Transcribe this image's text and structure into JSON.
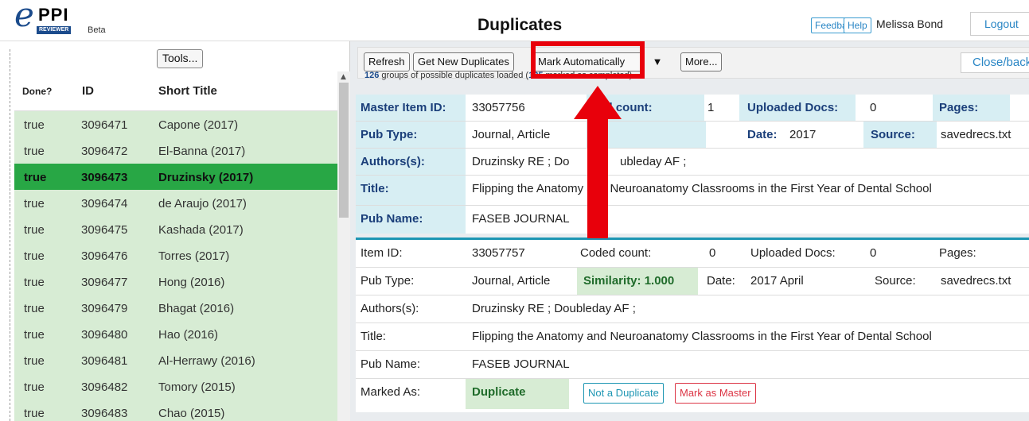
{
  "header": {
    "logo_letter": "e",
    "logo_main": "PPI",
    "logo_reviewer": "REVIEWER",
    "logo_beta": "Beta",
    "title": "Duplicates",
    "feedback": "Feedback",
    "help": "Help",
    "user": "Melissa Bond",
    "logout": "Logout"
  },
  "left": {
    "tools": "Tools...",
    "columns": {
      "done": "Done?",
      "id": "ID",
      "short_title": "Short Title"
    },
    "rows": [
      {
        "done": "true",
        "id": "3096471",
        "title": "Capone (2017)",
        "selected": false
      },
      {
        "done": "true",
        "id": "3096472",
        "title": "El-Banna (2017)",
        "selected": false
      },
      {
        "done": "true",
        "id": "3096473",
        "title": "Druzinsky (2017)",
        "selected": true
      },
      {
        "done": "true",
        "id": "3096474",
        "title": "de Araujo (2017)",
        "selected": false
      },
      {
        "done": "true",
        "id": "3096475",
        "title": "Kashada (2017)",
        "selected": false
      },
      {
        "done": "true",
        "id": "3096476",
        "title": "Torres (2017)",
        "selected": false
      },
      {
        "done": "true",
        "id": "3096477",
        "title": "Hong (2016)",
        "selected": false
      },
      {
        "done": "true",
        "id": "3096479",
        "title": "Bhagat (2016)",
        "selected": false
      },
      {
        "done": "true",
        "id": "3096480",
        "title": "Hao (2016)",
        "selected": false
      },
      {
        "done": "true",
        "id": "3096481",
        "title": "Al-Herrawy (2016)",
        "selected": false
      },
      {
        "done": "true",
        "id": "3096482",
        "title": "Tomory (2015)",
        "selected": false
      },
      {
        "done": "true",
        "id": "3096483",
        "title": "Chao (2015)",
        "selected": false
      }
    ]
  },
  "toolbar": {
    "refresh": "Refresh",
    "get_new": "Get New Duplicates",
    "mark_auto": "Mark Automatically",
    "dropdown_icon": "caret-down-icon",
    "more": "More...",
    "close_back": "Close/back",
    "status_count": "126",
    "status_mid": " groups of possible duplicates loaded (",
    "status_marked": "125",
    "status_end": " marked as completed)."
  },
  "master": {
    "item_id_label": "Master Item ID:",
    "item_id": "33057756",
    "coded_label": "ded count:",
    "coded": "1",
    "uploaded_label": "Uploaded Docs:",
    "uploaded": "0",
    "pages_label": "Pages:",
    "pubtype_label": "Pub Type:",
    "pubtype": "Journal, Article",
    "date_label": "Date:",
    "date": "2017",
    "source_label": "Source:",
    "source": "savedrecs.txt",
    "authors_label": "Authors(s):",
    "authors_a": "Druzinsky RE ; Do",
    "authors_b": "ubleday AF ;",
    "title_label": "Title:",
    "title": "Flipping the Anatomy and Neuroanatomy Classrooms in the First Year of Dental School",
    "pubname_label": "Pub Name:",
    "pubname": "FASEB JOURNAL"
  },
  "duplicate": {
    "item_id_label": "Item ID:",
    "item_id": "33057757",
    "coded_label": "Coded count:",
    "coded": "0",
    "uploaded_label": "Uploaded Docs:",
    "uploaded": "0",
    "pages_label": "Pages:",
    "pubtype_label": "Pub Type:",
    "pubtype": "Journal, Article",
    "similarity": "Similarity: 1.000",
    "date_label": "Date:",
    "date": "2017 April",
    "source_label": "Source:",
    "source": "savedrecs.txt",
    "authors_label": "Authors(s):",
    "authors": "Druzinsky RE ; Doubleday AF ;",
    "title_label": "Title:",
    "title": "Flipping the Anatomy and Neuroanatomy Classrooms in the First Year of Dental School",
    "pubname_label": "Pub Name:",
    "pubname": "FASEB JOURNAL",
    "marked_label": "Marked As:",
    "marked": "Duplicate",
    "not_dup": "Not a Duplicate",
    "mark_master": "Mark as Master"
  },
  "colors": {
    "accent": "#2a86c5",
    "selected_row": "#28a745",
    "row_bg": "#d7ecd4",
    "annotation": "#e8000b"
  }
}
